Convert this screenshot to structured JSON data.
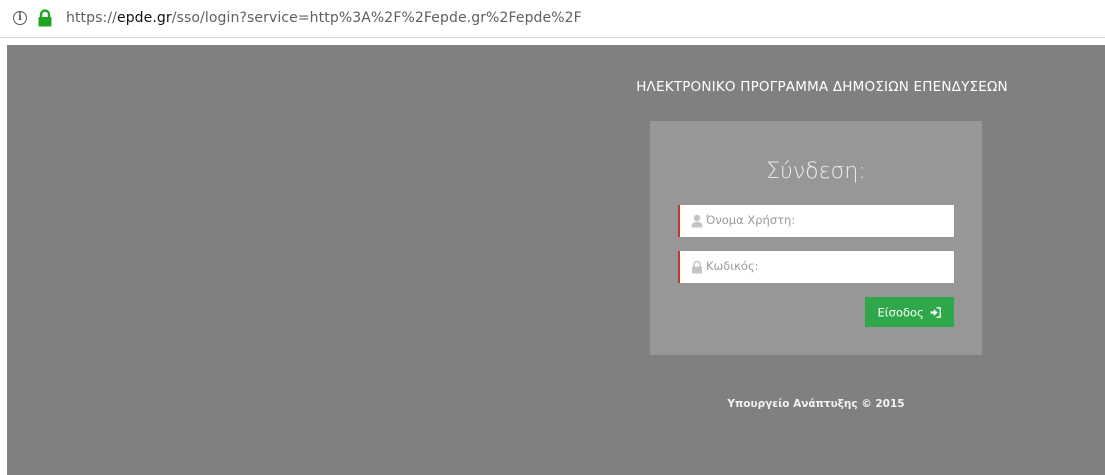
{
  "browser": {
    "url_scheme": "https://",
    "url_domain": "epde.gr",
    "url_path": "/sso/login?service=http%3A%2F%2Fepde.gr%2Fepde%2F",
    "info_icon": "info-icon",
    "lock_icon": "lock-icon",
    "lock_color": "#1fa51f"
  },
  "page": {
    "background_color": "#808080",
    "site_title": "ΗΛΕΚΤΡΟΝΙΚΟ ΠΡΟΓΡΑΜΜΑ ΔΗΜΟΣΙΩΝ ΕΠΕΝΔΥΣΕΩΝ",
    "footer": "Υπουργείο Ανάπτυξης © 2015"
  },
  "login": {
    "heading": "Σύνδεση:",
    "username": {
      "icon": "user-icon",
      "placeholder": "Όνομα Χρήστη:",
      "value": ""
    },
    "password": {
      "icon": "lock-icon",
      "placeholder": "Κωδικός:",
      "value": ""
    },
    "submit": {
      "label": "Είσοδος",
      "icon": "sign-in-icon",
      "color": "#2ea84a"
    }
  }
}
